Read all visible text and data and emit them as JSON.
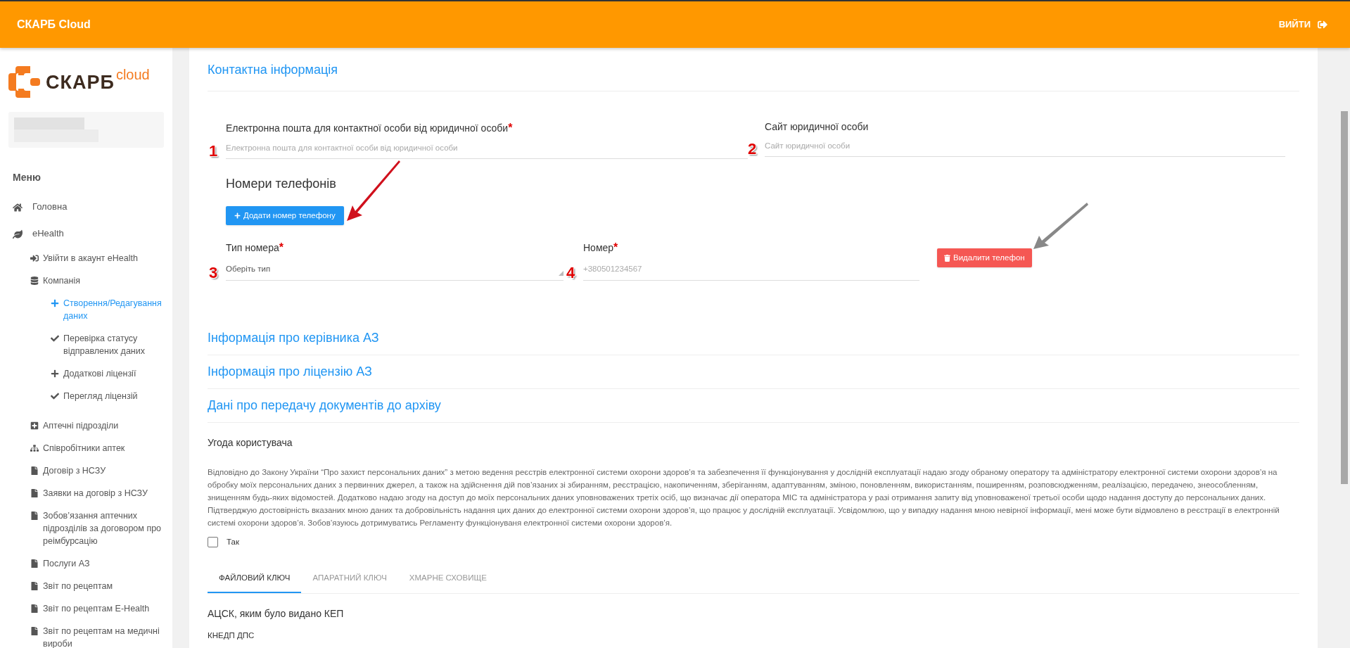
{
  "header": {
    "title": "СКАРБ Cloud",
    "logout": "ВИЙТИ"
  },
  "logo": {
    "name": "СКАРБ",
    "suffix": "cloud"
  },
  "sidebar": {
    "menu_title": "Меню",
    "items": [
      {
        "label": "Головна",
        "selected": false
      },
      {
        "label": "eHealth",
        "selected": false,
        "children": [
          {
            "label": "Увійти в акаунт eHealth",
            "selected": false
          },
          {
            "label": "Компанія",
            "selected": false,
            "children": [
              {
                "label": "Створення/Редагування даних",
                "selected": true
              },
              {
                "label": "Перевірка статусу відправлених даних",
                "selected": false
              },
              {
                "label": "Додаткові ліцензії",
                "selected": false
              },
              {
                "label": "Перегляд ліцензій",
                "selected": false
              }
            ]
          },
          {
            "label": "Аптечні підрозділи",
            "selected": false
          },
          {
            "label": "Співробітники аптек",
            "selected": false
          },
          {
            "label": "Договір з НСЗУ",
            "selected": false
          },
          {
            "label": "Заявки на договір з НСЗУ",
            "selected": false
          },
          {
            "label": "Зобов’язання аптечних підрозділів за договором про реімбурсацію",
            "selected": false
          },
          {
            "label": "Послуги АЗ",
            "selected": false
          },
          {
            "label": "Звіт по рецептам",
            "selected": false
          },
          {
            "label": "Звіт по рецептам E-Health",
            "selected": false
          },
          {
            "label": "Звіт по рецептам на медичні вироби",
            "selected": false
          }
        ]
      }
    ]
  },
  "contact": {
    "title": "Контактна інформація",
    "email": {
      "label": "Електронна пошта для контактної особи від юридичної особи",
      "required_mark": "*",
      "placeholder": "Електронна пошта для контактної особи від юридичної особи",
      "marker": "1"
    },
    "site": {
      "label": "Сайт юридичної особи",
      "placeholder": "Сайт юридичної особи",
      "marker": "2"
    },
    "phones_title": "Номери телефонів",
    "add_button": "Додати номер телефону",
    "phone_type": {
      "label": "Тип номера",
      "required_mark": "*",
      "placeholder": "Оберіть тип",
      "marker": "3"
    },
    "phone_number": {
      "label": "Номер",
      "required_mark": "*",
      "placeholder": "+380501234567",
      "marker": "4"
    },
    "delete_button": "Видалити телефон"
  },
  "sections": [
    "Інформація про керівника АЗ",
    "Інформація про ліцензію АЗ",
    "Дані про передачу документів до архіву"
  ],
  "agreement": {
    "title": "Угода користувача",
    "text": "Відповідно до Закону України “Про захист персональних даних” з метою ведення реєстрів електронної системи охорони здоров’я та забезпечення її функціонування у дослідній експлуатації надаю згоду обраному оператору та адміністратору електронної системи охорони здоров’я на обробку моїх персональних даних з первинних джерел, а також на здійснення дій пов’язаних зі збиранням, реєстрацією, накопиченням, зберіганням, адаптуванням, зміною, поновленням, використанням, поширенням, розповсюдженням, реалізацією, передачею, знеособленням, знищенням будь-яких відомостей. Додатково надаю згоду на доступ до моїх персональних даних уповноважених третіх осіб, що визначає дії оператора МІС та адміністратора у разі отримання запиту від уповноваженої третьої особи щодо надання доступу до персональних даних. Підтверджую достовірність вказаних мною даних та добровільність надання цих даних до електронної системи охорони здоров’я, що працює у дослідній експлуатації. Усвідомлюю, що у випадку надання мною невірної інформації, мені може бути відмовлено в реєстрації в електронній системі охорони здоров’я. Зобов’язуюсь дотримуватись Регламенту функціонуваня електронної системи охорони здоров’я.",
    "checkbox_label": "Так",
    "checked": false
  },
  "key_tabs": [
    {
      "label": "ФАЙЛОВИЙ КЛЮЧ",
      "selected": true
    },
    {
      "label": "АПАРАТНИЙ КЛЮЧ",
      "selected": false
    },
    {
      "label": "ХМАРНЕ СХОВИЩЕ",
      "selected": false
    }
  ],
  "key": {
    "label": "АЦСК, яким було видано КЕП",
    "value": "КНЕДП ДПС"
  }
}
